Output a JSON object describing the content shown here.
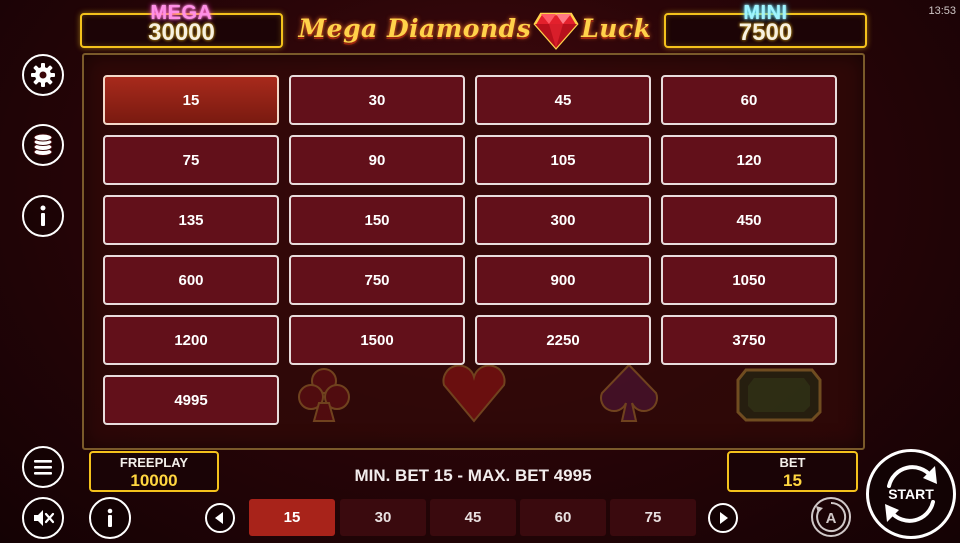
{
  "status_bar": {
    "time": "13:53"
  },
  "jackpots": {
    "mega": {
      "label": "MEGA",
      "value": "30000"
    },
    "mini": {
      "label": "MINI",
      "value": "7500"
    }
  },
  "logo": {
    "text_left": "Mega Diamonds",
    "text_right": "Luck"
  },
  "side_menu": {
    "icons": [
      "gear-icon",
      "coins-icon",
      "info-icon"
    ]
  },
  "bet_options": {
    "selected": "15",
    "values": [
      "15",
      "30",
      "45",
      "60",
      "75",
      "90",
      "105",
      "120",
      "135",
      "150",
      "300",
      "450",
      "600",
      "750",
      "900",
      "1050",
      "1200",
      "1500",
      "2250",
      "3750",
      "4995"
    ]
  },
  "bottom_bar": {
    "freeplay": {
      "label": "FREEPLAY",
      "value": "10000"
    },
    "limits_text": "MIN. BET 15 - MAX. BET 4995",
    "bet": {
      "label": "BET",
      "value": "15"
    },
    "quick_bets": [
      "15",
      "30",
      "45",
      "60",
      "75"
    ],
    "start_label": "START"
  },
  "colors": {
    "accent_gold": "#f4c21c",
    "mega_pink": "#ff8fe6",
    "mini_cyan": "#9ff4ff",
    "option_bg": "#62101a",
    "option_active": "#a82a1c"
  }
}
